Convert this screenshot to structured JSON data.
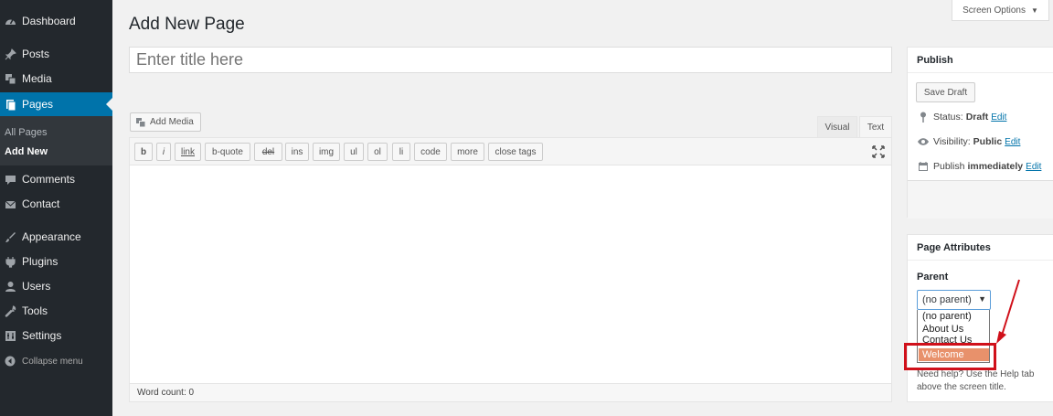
{
  "sidebar": {
    "items": [
      {
        "label": "Dashboard",
        "icon": "dashboard-icon"
      },
      {
        "label": "Posts",
        "icon": "pin-icon"
      },
      {
        "label": "Media",
        "icon": "media-icon"
      },
      {
        "label": "Pages",
        "icon": "pages-icon",
        "active": true
      },
      {
        "label": "Comments",
        "icon": "comment-icon"
      },
      {
        "label": "Contact",
        "icon": "envelope-icon"
      },
      {
        "label": "Appearance",
        "icon": "brush-icon"
      },
      {
        "label": "Plugins",
        "icon": "plug-icon"
      },
      {
        "label": "Users",
        "icon": "user-icon"
      },
      {
        "label": "Tools",
        "icon": "wrench-icon"
      },
      {
        "label": "Settings",
        "icon": "settings-icon"
      }
    ],
    "submenu": [
      "All Pages",
      "Add New"
    ],
    "collapse_label": "Collapse menu"
  },
  "screen_options": "Screen Options",
  "page_title": "Add New Page",
  "title_placeholder": "Enter title here",
  "add_media": "Add Media",
  "tabs": {
    "visual": "Visual",
    "text": "Text"
  },
  "quicktags": [
    "b",
    "i",
    "link",
    "b-quote",
    "del",
    "ins",
    "img",
    "ul",
    "ol",
    "li",
    "code",
    "more",
    "close tags"
  ],
  "word_count": "Word count: 0",
  "publish": {
    "title": "Publish",
    "save_draft": "Save Draft",
    "status_label": "Status:",
    "status_value": "Draft",
    "visibility_label": "Visibility:",
    "visibility_value": "Public",
    "publish_label": "Publish",
    "publish_value": "immediately",
    "edit": "Edit"
  },
  "page_attributes": {
    "title": "Page Attributes",
    "parent_label": "Parent",
    "selected": "(no parent)",
    "options": [
      "(no parent)",
      "About Us",
      "Contact Us",
      "Welcome"
    ],
    "highlighted_option": "Welcome",
    "help_text": "Need help? Use the Help tab above the screen title."
  },
  "colors": {
    "sidebar_bg": "#23282d",
    "active": "#0073aa",
    "highlight_option": "#e8916b",
    "annotation_red": "#d0101a"
  }
}
